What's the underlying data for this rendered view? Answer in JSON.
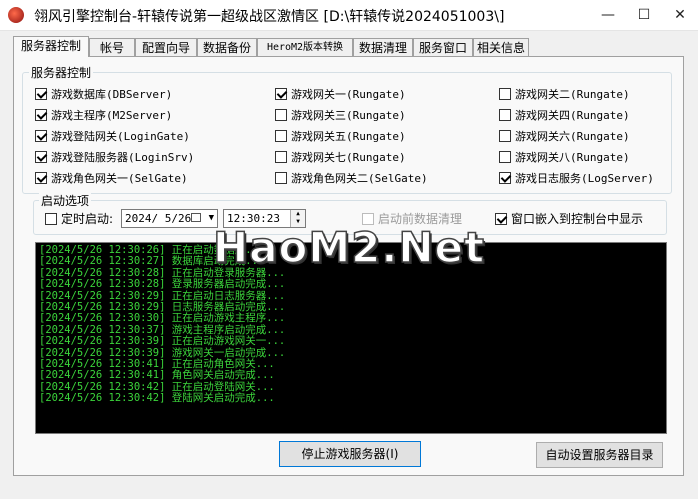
{
  "window": {
    "title": "翎风引擎控制台-轩辕传说第一超级战区激情区 [D:\\轩辕传说2024051003\\]",
    "minimize": "—",
    "maximize": "☐",
    "close": "✕"
  },
  "tabs": [
    "服务器控制",
    "帐号",
    "配置向导",
    "数据备份",
    "HeroM2版本转换",
    "数据清理",
    "服务窗口",
    "相关信息"
  ],
  "server_group": {
    "label": "服务器控制",
    "items": [
      {
        "label": "游戏数据库(DBServer)",
        "checked": true
      },
      {
        "label": "游戏网关一(Rungate)",
        "checked": true
      },
      {
        "label": "游戏网关二(Rungate)",
        "checked": false
      },
      {
        "label": "游戏主程序(M2Server)",
        "checked": true
      },
      {
        "label": "游戏网关三(Rungate)",
        "checked": false
      },
      {
        "label": "游戏网关四(Rungate)",
        "checked": false
      },
      {
        "label": "游戏登陆网关(LoginGate)",
        "checked": true
      },
      {
        "label": "游戏网关五(Rungate)",
        "checked": false
      },
      {
        "label": "游戏网关六(Rungate)",
        "checked": false
      },
      {
        "label": "游戏登陆服务器(LoginSrv)",
        "checked": true
      },
      {
        "label": "游戏网关七(Rungate)",
        "checked": false
      },
      {
        "label": "游戏网关八(Rungate)",
        "checked": false
      },
      {
        "label": "游戏角色网关一(SelGate)",
        "checked": true
      },
      {
        "label": "游戏角色网关二(SelGate)",
        "checked": false
      },
      {
        "label": "游戏日志服务(LogServer)",
        "checked": true
      }
    ]
  },
  "startup": {
    "label": "启动选项",
    "timed_start_label": "定时启动:",
    "timed_start_checked": false,
    "date_value": "2024/ 5/26",
    "time_value": "12:30:23",
    "clear_data_label": "启动前数据清理",
    "clear_data_checked": false,
    "embed_label": "窗口嵌入到控制台中显示",
    "embed_checked": true
  },
  "log": [
    "[2024/5/26 12:30:26] 正在启动数据库...",
    "[2024/5/26 12:30:27] 数据库启动完成...",
    "[2024/5/26 12:30:28] 正在启动登录服务器...",
    "[2024/5/26 12:30:28] 登录服务器启动完成...",
    "[2024/5/26 12:30:29] 正在启动日志服务器...",
    "[2024/5/26 12:30:29] 日志服务器启动完成...",
    "[2024/5/26 12:30:30] 正在启动游戏主程序...",
    "[2024/5/26 12:30:37] 游戏主程序启动完成...",
    "[2024/5/26 12:30:39] 正在启动游戏网关一...",
    "[2024/5/26 12:30:39] 游戏网关一启动完成...",
    "[2024/5/26 12:30:41] 正在启动角色网关...",
    "[2024/5/26 12:30:41] 角色网关启动完成...",
    "[2024/5/26 12:30:42] 正在启动登陆网关...",
    "[2024/5/26 12:30:42] 登陆网关启动完成..."
  ],
  "watermark": "HaoM2.Net",
  "buttons": {
    "stop": "停止游戏服务器(I)",
    "auto_dir": "自动设置服务器目录"
  }
}
